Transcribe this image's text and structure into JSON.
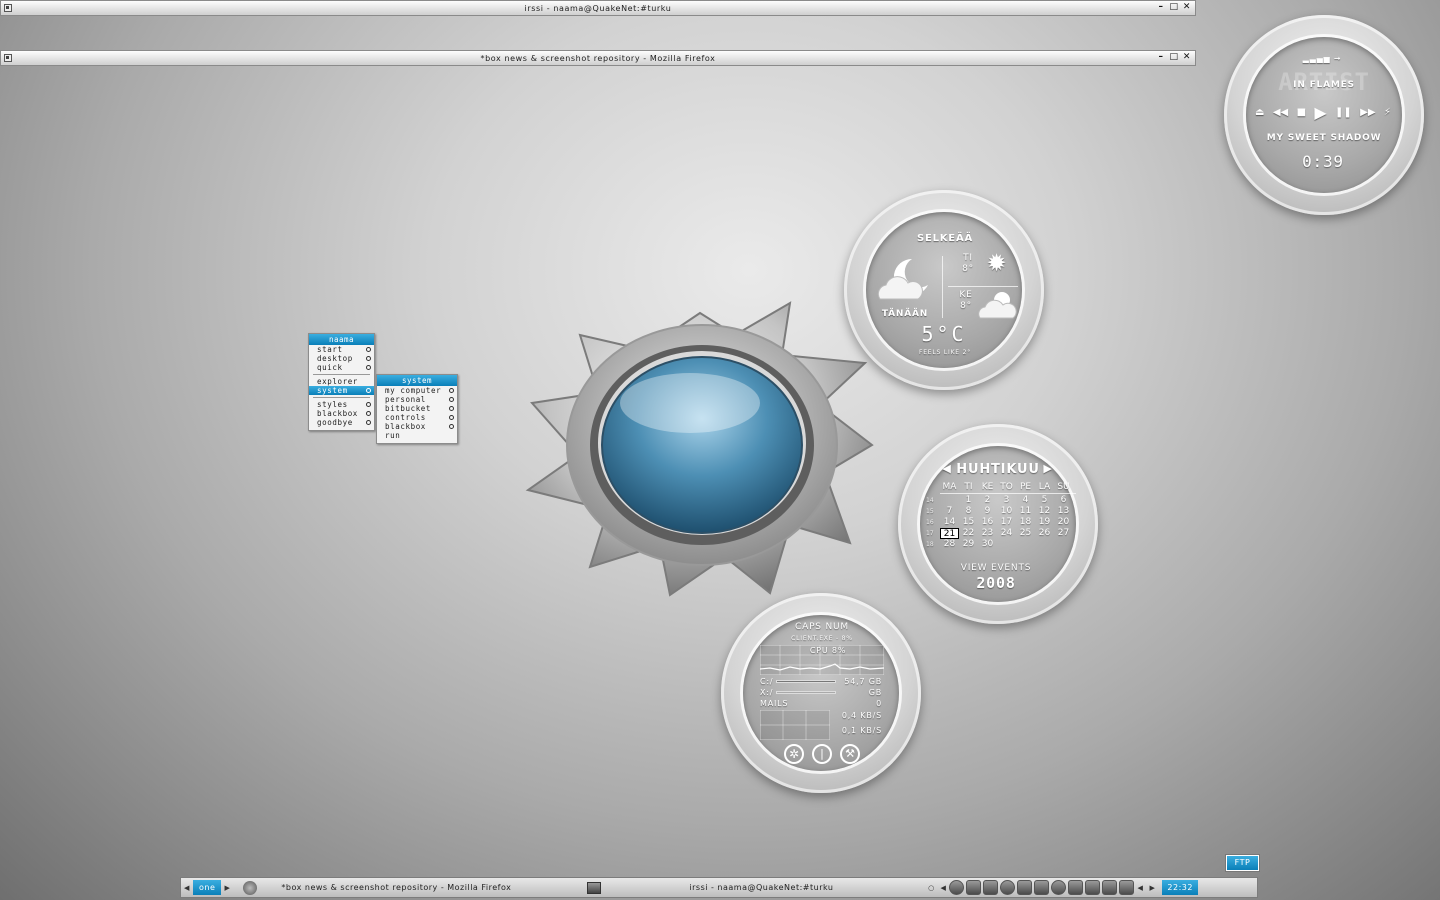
{
  "windows": {
    "irssi_title": "irssi - naama@QuakeNet:#turku",
    "firefox_title": "*box news & screenshot repository - Mozilla Firefox",
    "buttons": {
      "minimize": "–",
      "maximize": "□",
      "close": "✕"
    }
  },
  "root_menu": {
    "title": "naama",
    "items": [
      {
        "label": "start"
      },
      {
        "label": "desktop"
      },
      {
        "label": "quick"
      },
      {
        "label": "explorer"
      },
      {
        "label": "system"
      },
      {
        "label": "styles"
      },
      {
        "label": "blackbox"
      },
      {
        "label": "goodbye"
      }
    ]
  },
  "system_menu": {
    "title": "system",
    "items": [
      {
        "label": "my computer"
      },
      {
        "label": "personal"
      },
      {
        "label": "bitbucket"
      },
      {
        "label": "controls"
      },
      {
        "label": "blackbox"
      },
      {
        "label": "run"
      }
    ]
  },
  "player": {
    "artist": "IN FLAMES",
    "watermark": "ARTIST",
    "track": "MY SWEET SHADOW",
    "time": "0:39",
    "controls": [
      "eject",
      "prev",
      "stop",
      "play",
      "pause",
      "next",
      "shuffle"
    ]
  },
  "weather": {
    "condition": "SELKEÄÄ",
    "today_label": "TÄNÄÄN",
    "day1": {
      "day": "TI",
      "temp": "8°"
    },
    "day2": {
      "day": "KE",
      "temp": "8°"
    },
    "current_temp": "5°C",
    "feels_like": "FEELS LIKE 2°"
  },
  "calendar": {
    "month": "HUHTIKUU",
    "weekdays": [
      "MA",
      "TI",
      "KE",
      "TO",
      "PE",
      "LA",
      "SU"
    ],
    "weeks": [
      {
        "wk": "14",
        "days": [
          "",
          "1",
          "2",
          "3",
          "4",
          "5",
          "6"
        ]
      },
      {
        "wk": "15",
        "days": [
          "7",
          "8",
          "9",
          "10",
          "11",
          "12",
          "13"
        ]
      },
      {
        "wk": "16",
        "days": [
          "14",
          "15",
          "16",
          "17",
          "18",
          "19",
          "20"
        ]
      },
      {
        "wk": "17",
        "days": [
          "21",
          "22",
          "23",
          "24",
          "25",
          "26",
          "27"
        ]
      },
      {
        "wk": "18",
        "days": [
          "28",
          "29",
          "30",
          "",
          "",
          "",
          ""
        ]
      }
    ],
    "today": "21",
    "view_events": "VIEW EVENTS",
    "year": "2008"
  },
  "sysmon": {
    "locks": "CAPS  NUM",
    "process": "CLIENT.EXE - 8%",
    "cpu": "CPU 8%",
    "drive_c_label": "C:/",
    "drive_c_value": "54,7 GB",
    "drive_x_label": "X:/",
    "drive_x_value": "GB",
    "mails_label": "MAILS",
    "mails_value": "0",
    "net_down": "0,4 KB/S",
    "net_up": "0,1 KB/S"
  },
  "taskbar": {
    "workspace": "one",
    "tasks": [
      {
        "label": "*box news & screenshot repository - Mozilla Firefox"
      },
      {
        "label": "irssi - naama@QuakeNet:#turku"
      }
    ],
    "clock": "22:32",
    "ftp": "FTP"
  }
}
